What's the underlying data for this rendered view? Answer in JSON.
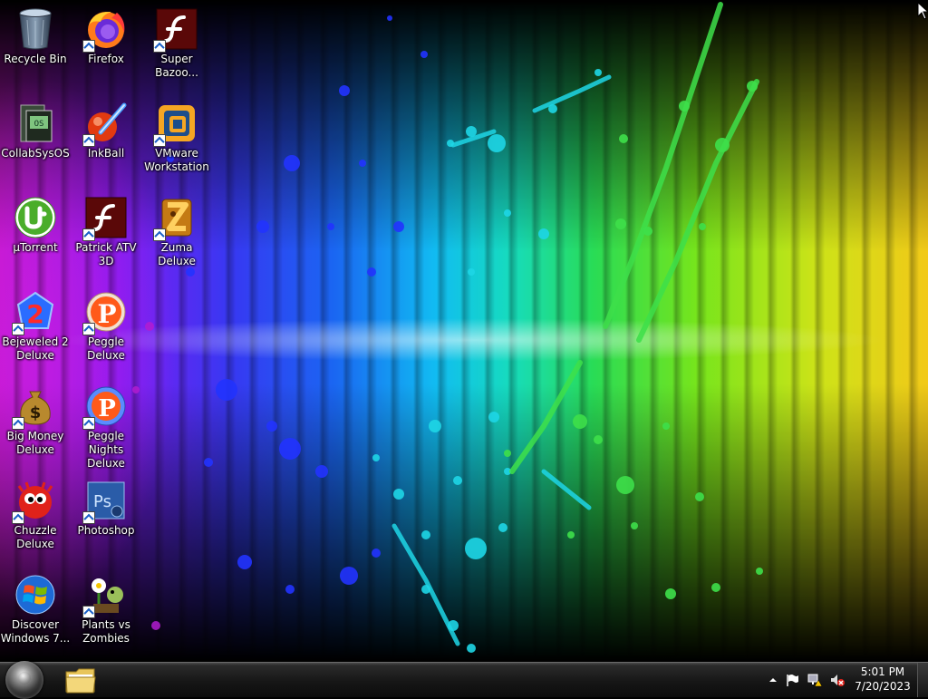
{
  "desktop": {
    "icons": [
      {
        "label": "Recycle Bin",
        "icon": "recycle-bin-icon"
      },
      {
        "label": "Firefox",
        "icon": "firefox-icon"
      },
      {
        "label": "Super Bazoo...",
        "icon": "flash-icon"
      },
      {
        "label": "CollabSysOS",
        "icon": "collabsysos-icon"
      },
      {
        "label": "InkBall",
        "icon": "inkball-icon"
      },
      {
        "label": "VMware Workstation",
        "icon": "vmware-icon"
      },
      {
        "label": "µTorrent",
        "icon": "utorrent-icon"
      },
      {
        "label": "Patrick ATV 3D",
        "icon": "flash-icon"
      },
      {
        "label": "Zuma Deluxe",
        "icon": "zuma-icon"
      },
      {
        "label": "Bejeweled 2 Deluxe",
        "icon": "bejeweled-icon"
      },
      {
        "label": "Peggle Deluxe",
        "icon": "peggle-icon"
      },
      {
        "label": "Big Money Deluxe",
        "icon": "money-bag-icon"
      },
      {
        "label": "Peggle Nights Deluxe",
        "icon": "peggle-nights-icon"
      },
      {
        "label": "Chuzzle Deluxe",
        "icon": "chuzzle-icon"
      },
      {
        "label": "Photoshop",
        "icon": "photoshop-icon"
      },
      {
        "label": "Discover Windows 7...",
        "icon": "windows-logo-icon"
      },
      {
        "label": "Plants vs Zombies",
        "icon": "plants-vs-zombies-icon"
      }
    ]
  },
  "taskbar": {
    "start_icon": "windows-orb-icon",
    "pinned": [
      {
        "icon": "folder-icon"
      }
    ],
    "tray_icons": [
      "chevron-up-icon",
      "flag-icon",
      "network-warning-icon",
      "speaker-muted-icon"
    ],
    "clock": {
      "time": "5:01 PM",
      "date": "7/20/2023"
    }
  },
  "colors": {
    "label_text": "#ffffff",
    "taskbar_bg": "#161616",
    "wallpaper_accent_magenta": "#d01bd6",
    "wallpaper_accent_cyan": "#12c7ff",
    "wallpaper_accent_green": "#2ce85a",
    "wallpaper_accent_yellow": "#ffd41a"
  }
}
